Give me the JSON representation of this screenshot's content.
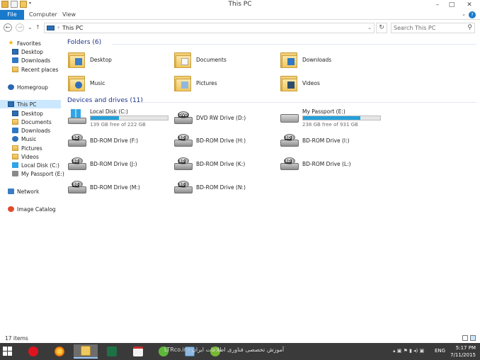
{
  "window": {
    "title": "This PC"
  },
  "ribbon": {
    "tabs": [
      "File",
      "Computer",
      "View"
    ]
  },
  "address": {
    "path": "This PC",
    "search_placeholder": "Search This PC"
  },
  "nav": {
    "favorites": "Favorites",
    "fav_items": [
      "Desktop",
      "Downloads",
      "Recent places"
    ],
    "homegroup": "Homegroup",
    "thispc": "This PC",
    "pc_items": [
      "Desktop",
      "Documents",
      "Downloads",
      "Music",
      "Pictures",
      "Videos",
      "Local Disk (C:)",
      "My Passport (E:)"
    ],
    "network": "Network",
    "image_catalog": "Image Catalog"
  },
  "folders": {
    "header": "Folders (6)",
    "items": [
      "Desktop",
      "Documents",
      "Downloads",
      "Music",
      "Pictures",
      "Videos"
    ]
  },
  "devices": {
    "header": "Devices and drives (11)",
    "local_c": {
      "name": "Local Disk (C:)",
      "free": "139 GB free of 222 GB",
      "used_fraction": 0.37
    },
    "dvd_d": {
      "name": "DVD RW Drive (D:)",
      "badge": "DVD"
    },
    "passport_e": {
      "name": "My Passport (E:)",
      "free": "238 GB free of 931 GB",
      "used_fraction": 0.74
    },
    "bd": [
      "BD-ROM Drive (F:)",
      "BD-ROM Drive (H:)",
      "BD-ROM Drive (I:)",
      "BD-ROM Drive (J:)",
      "BD-ROM Drive (K:)",
      "BD-ROM Drive (L:)",
      "BD-ROM Drive (M:)",
      "BD-ROM Drive (N:)"
    ],
    "bd_badge": "BD"
  },
  "status": {
    "count": "17 items"
  },
  "taskbar": {
    "watermark": "LTRco.ir - آموزش تخصصی فناوری اطلاعات ایران",
    "lang": "ENG",
    "time": "5:17 PM",
    "date": "7/11/2015"
  }
}
